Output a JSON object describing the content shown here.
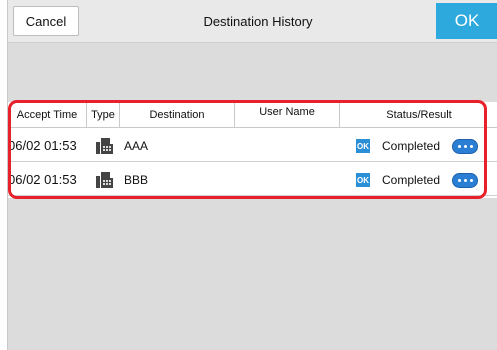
{
  "topbar": {
    "cancel_label": "Cancel",
    "title": "Destination History",
    "ok_label": "OK"
  },
  "table": {
    "headers": {
      "accept_time": "Accept Time",
      "type": "Type",
      "destination": "Destination",
      "user_name": "User Name",
      "status": "Status/Result"
    },
    "rows": [
      {
        "time": "06/02 01:53",
        "type_icon": "fax-icon",
        "destination": "AAA",
        "badge": "OK",
        "status": "Completed"
      },
      {
        "time": "06/02 01:53",
        "type_icon": "fax-icon",
        "destination": "BBB",
        "badge": "OK",
        "status": "Completed"
      }
    ]
  },
  "colors": {
    "accent": "#2ea9de",
    "highlight": "#e8202a",
    "background": "#dcdcdc"
  }
}
